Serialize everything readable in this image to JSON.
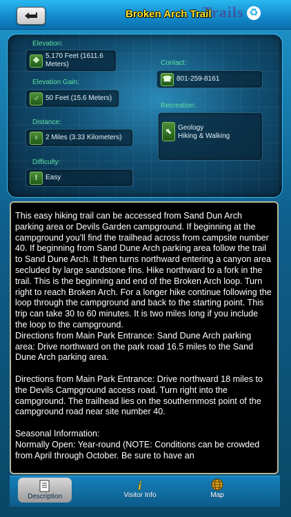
{
  "header": {
    "title": "Broken Arch Trail",
    "logo": "Trails",
    "back_icon": "back-arrow-icon"
  },
  "info": {
    "elevation": {
      "label": "Elevation:",
      "value_line1": "5,170 Feet (1611.6",
      "value_line2": "Meters)"
    },
    "elevation_gain": {
      "label": "Elevation  Gain:",
      "value": "50 Feet (15.6 Meters)"
    },
    "distance": {
      "label": "Distance:",
      "value": "2 Miles (3.33 Kilometers)"
    },
    "difficulty": {
      "label": "Difficulty:",
      "value": "Easy"
    },
    "contact": {
      "label": "Contact:",
      "value": "801-259-8161"
    },
    "recreation": {
      "label": "Recreation:",
      "items": [
        "Geology",
        "Hiking & Walking"
      ]
    }
  },
  "description": "This easy hiking trail can be accessed from Sand Dun Arch parking area or Devils Garden campground. If beginning at the campground you'll find the trailhead across from campsite number 40. If beginning from Sand Dune Arch parking area follow the trail to Sand Dune Arch. It then turns northward entering a canyon area secluded by large sandstone fins. Hike northward to a fork in the trail. This is the beginning and end of the Broken Arch loop. Turn right to reach Broken Arch. For a longer hike continue following the loop through the campground and back to the starting point. This trip can take 30 to 60 minutes. It is two miles long if you include the loop to the campground.\nDirections from Main Park Entrance: Sand Dune Arch parking area: Drive northward on the park road 16.5 miles to the Sand Dune Arch parking area.\n\nDirections from Main Park Entrance: Drive northward 18 miles to the Devils Campground access road. Turn right into the campground. The trailhead lies on the southernmost point of the campground road near site number 40.\n\nSeasonal Information:\nNormally Open: Year-round (NOTE: Conditions can be crowded from April through October. Be sure to have an",
  "tabs": [
    {
      "label": "Description",
      "icon": "document-icon",
      "active": true
    },
    {
      "label": "Visitor Info",
      "icon": "info-icon",
      "active": false
    },
    {
      "label": "Map",
      "icon": "globe-icon",
      "active": false
    }
  ],
  "colors": {
    "title": "#ffe632",
    "label": "#5fe4a0",
    "topbar": "#1590d0"
  }
}
